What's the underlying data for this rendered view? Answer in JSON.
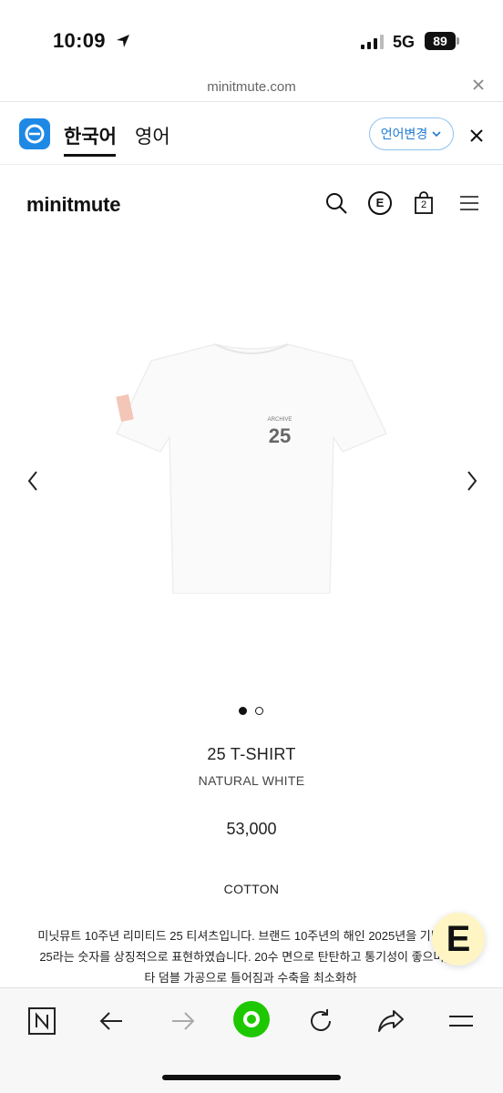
{
  "status_bar": {
    "time": "10:09",
    "network": "5G",
    "battery": "89"
  },
  "browser": {
    "url": "minitmute.com"
  },
  "translate_bar": {
    "tab_korean": "한국어",
    "tab_english": "영어",
    "change_language": "언어변경"
  },
  "site": {
    "brand": "minitmute",
    "cart_count": "2",
    "e_badge": "E"
  },
  "product": {
    "print_small": "ARCHIVE",
    "print_large": "25",
    "name": "25 T-SHIRT",
    "color": "NATURAL WHITE",
    "price": "53,000",
    "material": "COTTON",
    "description": "미닛뮤트 10주년 리미티드 25 티셔츠입니다. 브랜드 10주년의 해인 2025년을 기념하며 25라는 숫자를 상징적으로 표현하였습니다. 20수 면으로 탄탄하고 통기성이 좋으며, 텐타 덤블 가공으로 틀어짐과 수축을 최소화하",
    "image_count": 2,
    "active_image": 1
  },
  "fab": {
    "label": "E"
  },
  "colors": {
    "accent_blue": "#1e88e5",
    "fab_bg": "#fff5c4",
    "toolbar_green": "#1ec800"
  }
}
